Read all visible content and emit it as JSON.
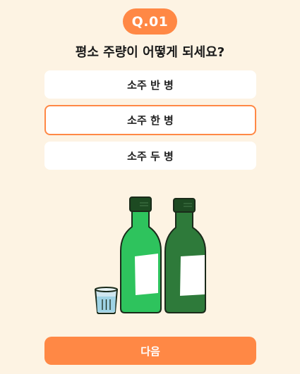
{
  "question_badge": "Q.01",
  "question_text": "평소 주량이 어떻게 되세요?",
  "options": [
    {
      "label": "소주 반 병",
      "selected": false
    },
    {
      "label": "소주 한 병",
      "selected": true
    },
    {
      "label": "소주 두 병",
      "selected": false
    }
  ],
  "illustration": {
    "icons": [
      "soju-bottle-light-icon",
      "soju-bottle-dark-icon",
      "soju-shot-glass-icon"
    ],
    "colors": {
      "bottle_light": "#2ec35d",
      "bottle_dark": "#2e7a3a",
      "cap": "#1d4a22",
      "label": "#ffffff",
      "glass": "#cfe6ef",
      "liquid": "#9fd3e5"
    }
  },
  "next_button_label": "다음",
  "colors": {
    "accent": "#ff8845",
    "background": "#fdf3e3",
    "option_background": "#ffffff",
    "text": "#1a1a1a"
  }
}
